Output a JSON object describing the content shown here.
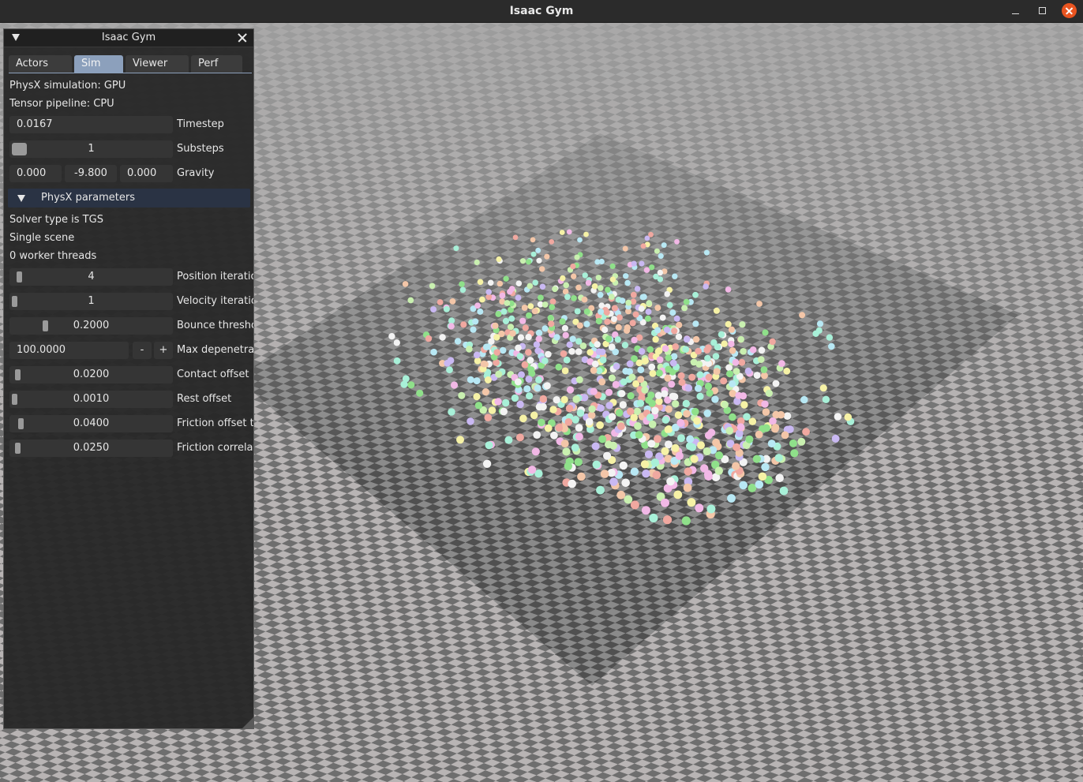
{
  "window": {
    "title": "Isaac Gym"
  },
  "panel": {
    "title": "Isaac Gym",
    "tabs": [
      {
        "label": "Actors",
        "active": false
      },
      {
        "label": "Sim",
        "active": true
      },
      {
        "label": "Viewer",
        "active": false
      },
      {
        "label": "Perf",
        "active": false
      }
    ],
    "info": {
      "physx_simulation": "PhysX simulation: GPU",
      "tensor_pipeline": "Tensor pipeline: CPU"
    },
    "timestep": {
      "value": "0.0167",
      "label": "Timestep"
    },
    "substeps": {
      "value": "1",
      "label": "Substeps"
    },
    "gravity": {
      "x": "0.000",
      "y": "-9.800",
      "z": "0.000",
      "label": "Gravity"
    },
    "physx_section": {
      "label": "PhysX parameters",
      "solver_type": "Solver type is TGS",
      "scene": "Single scene",
      "worker_threads": "0 worker threads",
      "sliders": [
        {
          "value": "4",
          "label": "Position iteratio",
          "fraction": 0.03
        },
        {
          "value": "1",
          "label": "Velocity iteratio",
          "fraction": 0.0
        },
        {
          "value": "0.2000",
          "label": "Bounce thresho",
          "fraction": 0.2
        },
        {
          "value": "0.0200",
          "label": "Contact offset",
          "fraction": 0.02
        },
        {
          "value": "0.0010",
          "label": "Rest offset",
          "fraction": 0.0
        },
        {
          "value": "0.0400",
          "label": "Friction offset t",
          "fraction": 0.04
        },
        {
          "value": "0.0250",
          "label": "Friction correlat",
          "fraction": 0.02
        }
      ],
      "max_depenetration": {
        "value": "100.0000",
        "label": "Max depenetrat",
        "minus": "-",
        "plus": "+"
      }
    }
  },
  "colors": {
    "accent_tab": "#8ca0bc",
    "close_button": "#e95420",
    "section_header": "#2a3344"
  }
}
